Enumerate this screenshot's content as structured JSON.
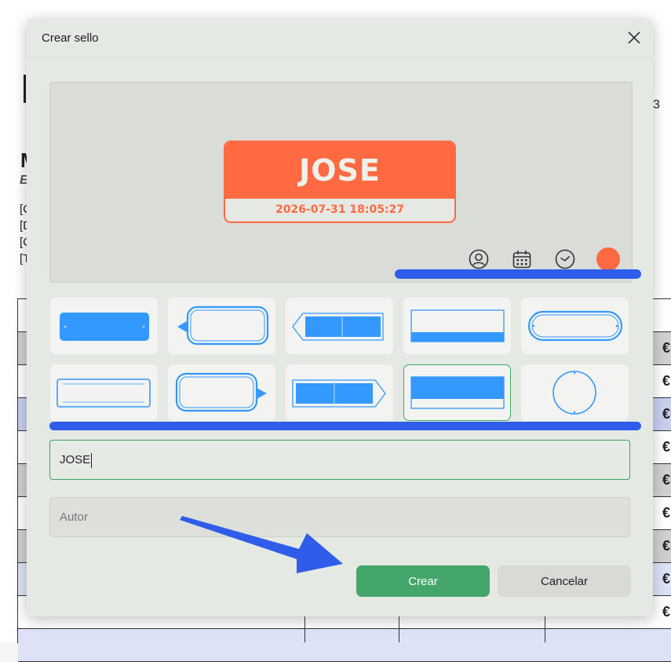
{
  "dialog": {
    "title": "Crear sello",
    "preview": {
      "stamp_name": "JOSE",
      "stamp_datetime": "2026-07-31 18:05:27",
      "stamp_color": "#ff6a42",
      "tools": [
        "user-icon",
        "calendar-icon",
        "clock-icon",
        "color-picker"
      ]
    },
    "templates": [
      "filled-rounded",
      "arrow-left-outline",
      "double-arrow-filled",
      "band-bottom",
      "rounded-pill",
      "double-outline",
      "arrow-right-outline",
      "split-arrow-filled",
      "top-filled-band",
      "circle"
    ],
    "selected_template": "top-filled-band",
    "name_input": {
      "value": "JOSE"
    },
    "author_input": {
      "placeholder": "Autor"
    },
    "buttons": {
      "create": "Crear",
      "cancel": "Cancelar"
    }
  },
  "background_document": {
    "fragments": [
      "3",
      "M",
      "E",
      "[C",
      "[D",
      "[C",
      "[T"
    ],
    "currency_symbol": "€"
  },
  "colors": {
    "accent_green": "#44a66b",
    "stamp_orange": "#ff6a42",
    "template_blue": "#3399ff",
    "annotation_blue": "#2f5ce8"
  }
}
